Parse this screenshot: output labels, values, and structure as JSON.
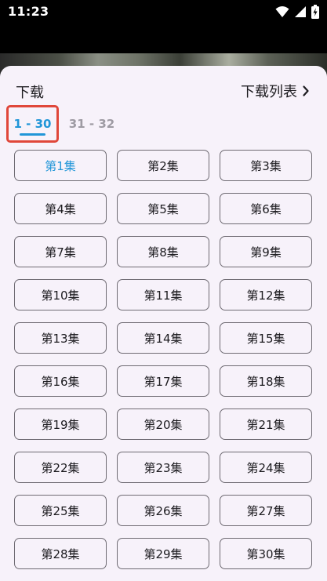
{
  "status_bar": {
    "time": "11:23",
    "icons": [
      "wifi-icon",
      "signal-icon",
      "battery-charging-icon"
    ]
  },
  "sheet": {
    "title": "下载",
    "download_list_label": "下载列表",
    "download_list_icon": "chevron-right-icon"
  },
  "tabs": [
    {
      "label": "1 - 30",
      "active": true
    },
    {
      "label": "31 - 32",
      "active": false
    }
  ],
  "episodes": [
    {
      "label": "第1集",
      "selected": true
    },
    {
      "label": "第2集",
      "selected": false
    },
    {
      "label": "第3集",
      "selected": false
    },
    {
      "label": "第4集",
      "selected": false
    },
    {
      "label": "第5集",
      "selected": false
    },
    {
      "label": "第6集",
      "selected": false
    },
    {
      "label": "第7集",
      "selected": false
    },
    {
      "label": "第8集",
      "selected": false
    },
    {
      "label": "第9集",
      "selected": false
    },
    {
      "label": "第10集",
      "selected": false
    },
    {
      "label": "第11集",
      "selected": false
    },
    {
      "label": "第12集",
      "selected": false
    },
    {
      "label": "第13集",
      "selected": false
    },
    {
      "label": "第14集",
      "selected": false
    },
    {
      "label": "第15集",
      "selected": false
    },
    {
      "label": "第16集",
      "selected": false
    },
    {
      "label": "第17集",
      "selected": false
    },
    {
      "label": "第18集",
      "selected": false
    },
    {
      "label": "第19集",
      "selected": false
    },
    {
      "label": "第20集",
      "selected": false
    },
    {
      "label": "第21集",
      "selected": false
    },
    {
      "label": "第22集",
      "selected": false
    },
    {
      "label": "第23集",
      "selected": false
    },
    {
      "label": "第24集",
      "selected": false
    },
    {
      "label": "第25集",
      "selected": false
    },
    {
      "label": "第26集",
      "selected": false
    },
    {
      "label": "第27集",
      "selected": false
    },
    {
      "label": "第28集",
      "selected": false
    },
    {
      "label": "第29集",
      "selected": false
    },
    {
      "label": "第30集",
      "selected": false
    }
  ],
  "colors": {
    "accent": "#2196d8",
    "highlight_border": "#e0473a",
    "sheet_background": "#f7f2fa",
    "button_border": "#6f6b73",
    "inactive_tab": "#9e9ba3"
  }
}
